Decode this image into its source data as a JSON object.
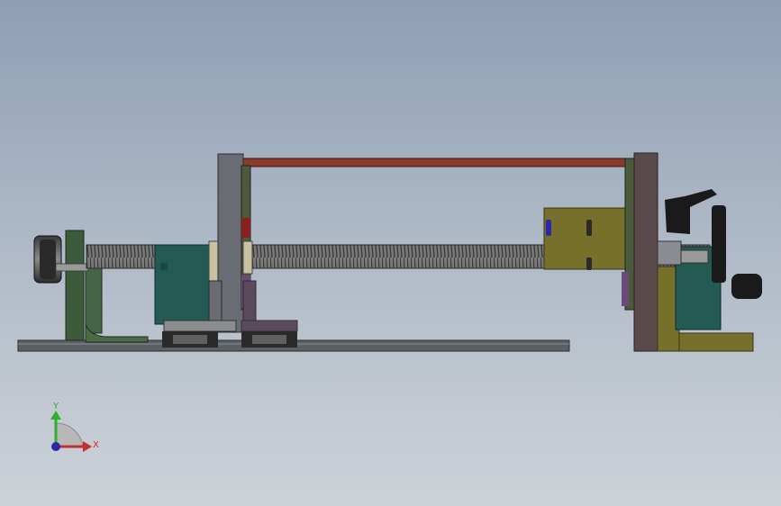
{
  "viewport": {
    "background_top": "#8e9eb4",
    "background_bottom": "#cdd2d8"
  },
  "triad": {
    "y_label": "Y",
    "x_label": "X",
    "y_color": "#2fae2f",
    "x_color": "#c43030",
    "z_color": "#2a2aa8"
  },
  "colors": {
    "base_rail": "#5c5f64",
    "screw": "#6a6a6a",
    "tie_rod": "#8a3a2c",
    "frame_plate": "#5a4a4c",
    "motor": "#245a54",
    "bracket_yellow": "#77702a",
    "bracket_green": "#3d5a3a",
    "handle": "#1a1a1a"
  }
}
